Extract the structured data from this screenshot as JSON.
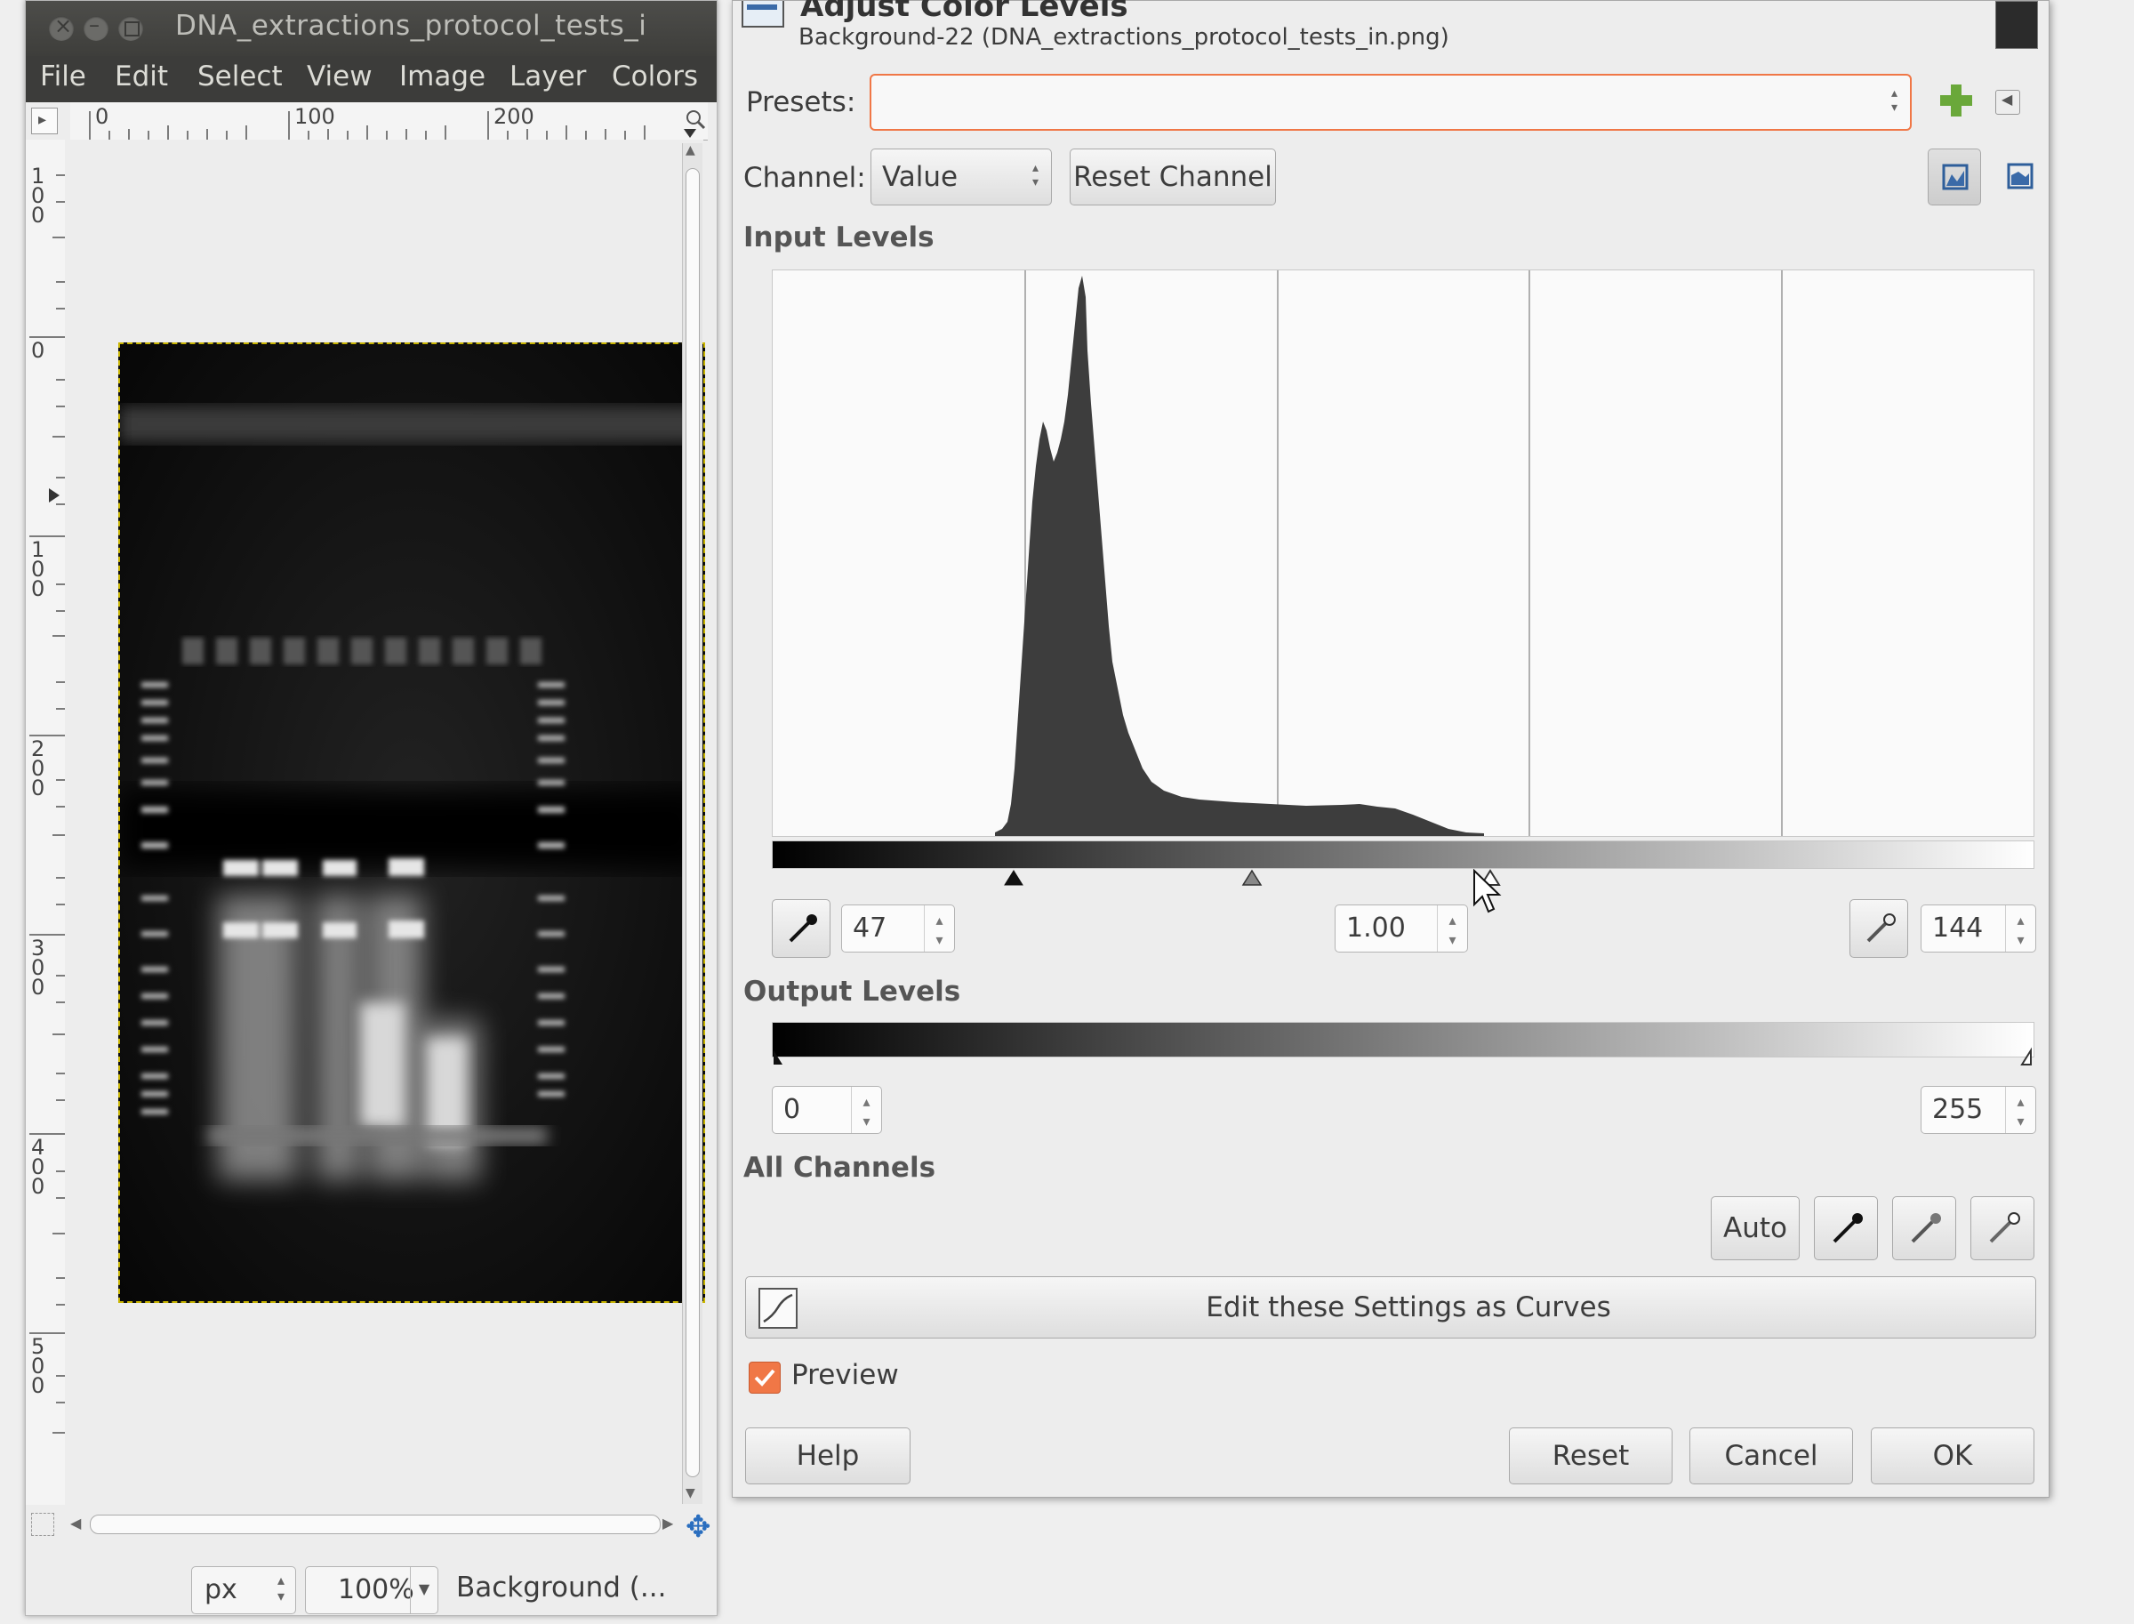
{
  "image_window": {
    "title": "DNA_extractions_protocol_tests_i",
    "menu": [
      "File",
      "Edit",
      "Select",
      "View",
      "Image",
      "Layer",
      "Colors"
    ],
    "ruler_h_labels": [
      "0",
      "100",
      "200"
    ],
    "ruler_v_labels": [
      "100",
      "0",
      "100",
      "200",
      "300",
      "400",
      "500"
    ],
    "unit": "px",
    "zoom": "100%",
    "layer_label": "Background (..."
  },
  "dialog": {
    "title": "Adjust Color Levels",
    "subtitle": "Background-22 (DNA_extractions_protocol_tests_in.png)",
    "presets_label": "Presets:",
    "presets_value": "",
    "channel_label": "Channel:",
    "channel_value": "Value",
    "reset_channel": "Reset Channel",
    "input_levels": "Input Levels",
    "input_low": "47",
    "input_gamma": "1.00",
    "input_high": "144",
    "output_levels": "Output Levels",
    "output_low": "0",
    "output_high": "255",
    "all_channels": "All Channels",
    "auto": "Auto",
    "edit_curves": "Edit these Settings as Curves",
    "preview": "Preview",
    "preview_checked": true,
    "help": "Help",
    "reset": "Reset",
    "cancel": "Cancel",
    "ok": "OK",
    "colors": {
      "accent": "#f07746",
      "plus": "#6aa83a"
    }
  }
}
